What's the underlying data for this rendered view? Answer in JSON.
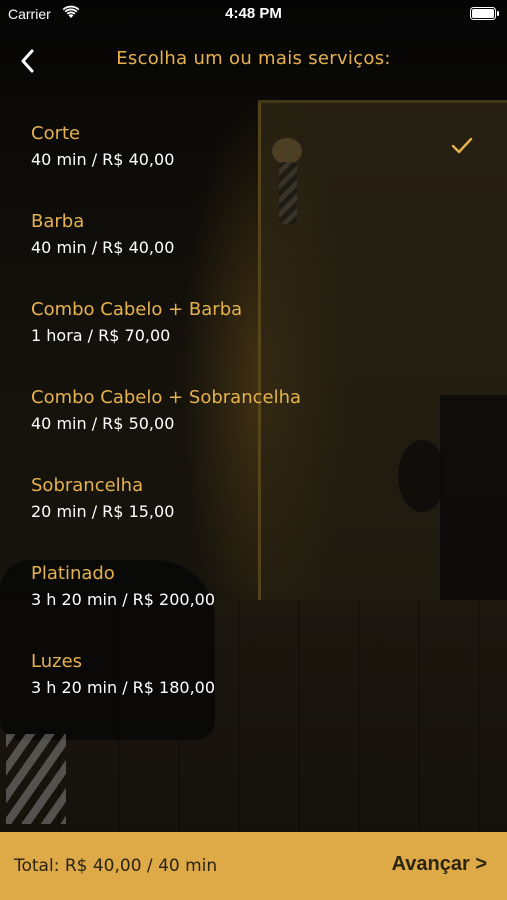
{
  "status_bar": {
    "carrier": "Carrier",
    "time": "4:48 PM",
    "icons": [
      "wifi-icon",
      "battery-icon"
    ]
  },
  "nav": {
    "back_icon": "chevron-left-icon",
    "title": "Escolha um ou mais serviços:"
  },
  "colors": {
    "accent": "#e6b24e",
    "footer": "#dea947",
    "footer_text": "#2a2413",
    "detail_text": "#ffffff"
  },
  "services": [
    {
      "name": "Corte",
      "detail": "40 min / R$ 40,00",
      "selected": true
    },
    {
      "name": "Barba",
      "detail": "40 min / R$ 40,00",
      "selected": false
    },
    {
      "name": "Combo Cabelo + Barba",
      "detail": "1 hora / R$ 70,00",
      "selected": false
    },
    {
      "name": "Combo Cabelo + Sobrancelha",
      "detail": "40 min / R$ 50,00",
      "selected": false
    },
    {
      "name": "Sobrancelha",
      "detail": "20 min / R$ 15,00",
      "selected": false
    },
    {
      "name": "Platinado",
      "detail": "3 h 20 min / R$ 200,00",
      "selected": false
    },
    {
      "name": "Luzes",
      "detail": "3 h 20 min / R$ 180,00",
      "selected": false
    }
  ],
  "footer": {
    "total": "Total: R$ 40,00 / 40 min",
    "advance_label": "Avançar >"
  }
}
